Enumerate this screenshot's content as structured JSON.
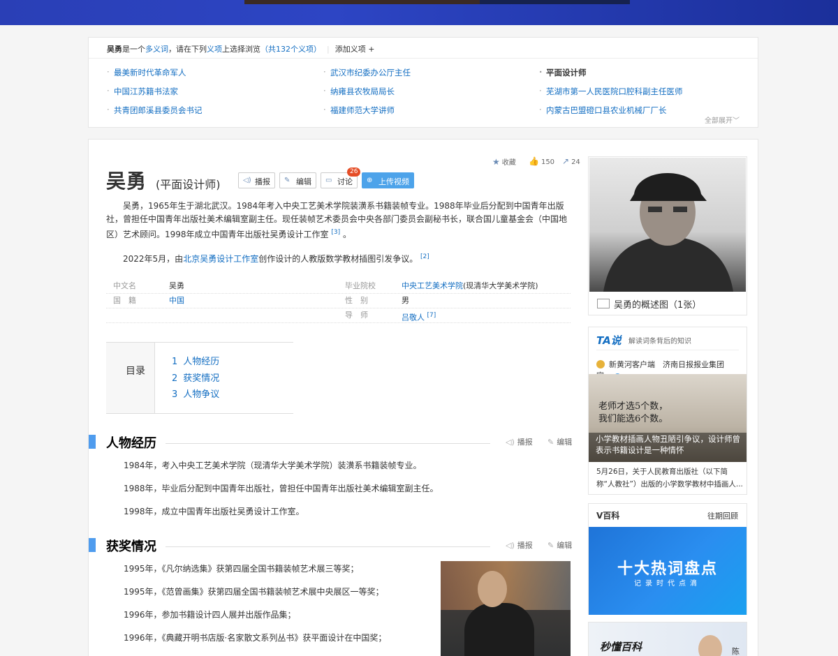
{
  "poly": {
    "name": "吴勇",
    "text1": "是一个",
    "link1": "多义词",
    "text2": "，请在下列",
    "link2": "义项",
    "text3": "上选择浏览",
    "count": "（共132个义项）",
    "add": "添加义项 +",
    "items": [
      "最美新时代革命军人",
      "武汉市纪委办公厅主任",
      "平面设计师",
      "中国江苏籍书法家",
      "纳雍县农牧局局长",
      "芜湖市第一人民医院口腔科副主任医师",
      "共青团郎溪县委员会书记",
      "福建师范大学讲师",
      "内蒙古巴盟磴口县农业机械厂厂长"
    ],
    "more": "全部展开"
  },
  "header": {
    "title": "吴勇",
    "subtitle": "(平面设计师)",
    "btn_play": "播报",
    "btn_edit": "编辑",
    "btn_discuss": "讨论",
    "discuss_badge": "26",
    "btn_upload": "上传视频",
    "collect": "收藏",
    "likes": "150",
    "shares": "24"
  },
  "summary": {
    "p1": "吴勇，1965年生于湖北武汉。1984年考入中央工艺美术学院装潢系书籍装帧专业。1988年毕业后分配到中国青年出版社，曾担任中国青年出版社美术编辑室副主任。现任装帧艺术委员会中央各部门委员会副秘书长，联合国儿童基金会（中国地区）艺术顾问。1998年成立中国青年出版社吴勇设计工作室",
    "p1_ref": "[3]",
    "p1_end": "。",
    "p2_a": "2022年5月，由",
    "p2_link": "北京吴勇设计工作室",
    "p2_b": "创作设计的人教版数学教材插图引发争议。",
    "p2_ref": "[2]"
  },
  "basic": {
    "k1": "中文名",
    "v1": "吴勇",
    "k2": "国　籍",
    "v2": "中国",
    "k3": "毕业院校",
    "v3_link": "中央工艺美术学院",
    "v3_rest": "(现清华大学美术学院)",
    "k4": "性　别",
    "v4": "男",
    "k5": "导　师",
    "v5": "吕敬人",
    "v5_ref": "[7]"
  },
  "toc": {
    "label": "目录",
    "items": [
      {
        "n": "1",
        "t": "人物经历"
      },
      {
        "n": "2",
        "t": "获奖情况"
      },
      {
        "n": "3",
        "t": "人物争议"
      }
    ]
  },
  "sections": {
    "s1": "人物经历",
    "s2": "获奖情况",
    "play": "播报",
    "edit": "编辑",
    "s1_lines": [
      "1984年，考入中央工艺美术学院（现清华大学美术学院）装潢系书籍装帧专业。",
      "1988年，毕业后分配到中国青年出版社，曾担任中国青年出版社美术编辑室副主任。",
      "1998年，成立中国青年出版社吴勇设计工作室。"
    ],
    "s2_lines": [
      "1995年，《凡尔纳选集》获第四届全国书籍装帧艺术展三等奖；",
      "1995年，《范曾画集》获第四届全国书籍装帧艺术展中央展区一等奖；",
      "1996年，参加书籍设计四人展并出版作品集；",
      "1996年，《典藏开明书店版·名家散文系列丛书》获平面设计在中国奖；"
    ]
  },
  "sidebar": {
    "album_caption": "吴勇的概述图（1张）",
    "ta_logo": "TA说",
    "ta_slogan": "解读词条背后的知识",
    "ta_source": "新黄河客户端　济南日报报业集团官...",
    "ta_hand1": "老师才选5个数，",
    "ta_hand2": "我们能选6个数。",
    "ta_title": "小学教材插画人物丑陋引争议，设计师曾表示书籍设计是一种情怀",
    "ta_desc": "5月26日，关于人民教育出版社（以下简称“人教社”）出版的小学数学教材中插画人...",
    "wb_head": "V百科",
    "wb_link": "往期回顾",
    "wb_big": "十大热词盘点",
    "wb_small": "记录时代点滴",
    "sd_logo": "秒懂百科",
    "sd_name": "陈"
  }
}
